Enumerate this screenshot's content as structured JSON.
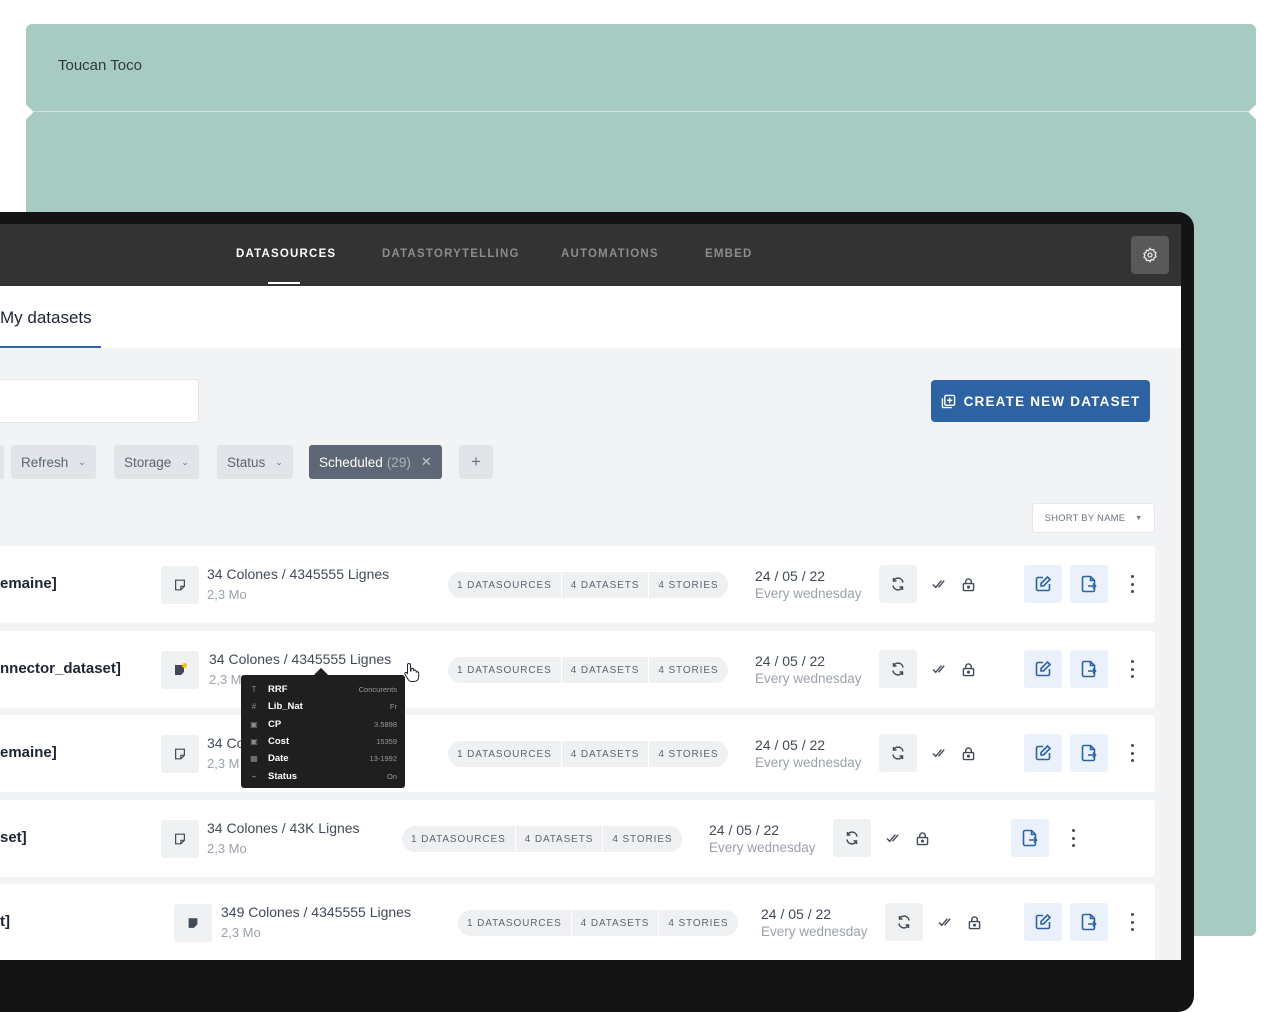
{
  "brand": "Toucan Toco",
  "nav": {
    "items": [
      "DATASOURCES",
      "DATASTORYTELLING",
      "AUTOMATIONS",
      "EMBED"
    ],
    "active": "DATASOURCES"
  },
  "tab": {
    "label": "My datasets"
  },
  "create_button": {
    "label": "CREATE NEW DATASET"
  },
  "filters": {
    "refresh": "Refresh",
    "storage": "Storage",
    "status": "Status",
    "scheduled": "Scheduled",
    "scheduled_count": "(29)",
    "add": "+"
  },
  "sort": {
    "label": "SHORT BY NAME"
  },
  "pills": {
    "datasources": "1 DATASOURCES",
    "datasets": "4 DATASETS",
    "stories": "4 STORIES"
  },
  "rows": [
    {
      "name": "emaine]",
      "colones": "34 Colones",
      "lignes": "/ 4345555 Lignes",
      "size": "2,3 Mo",
      "date": "24 / 05 / 22",
      "schedule": "Every wednesday"
    },
    {
      "name": "nnector_dataset]",
      "colones": "34 Colones",
      "lignes": "/ 4345555 Lignes",
      "size": "2,3 Mo",
      "date": "24 / 05 / 22",
      "schedule": "Every wednesday"
    },
    {
      "name": "emaine]",
      "colones": "34 Co",
      "lignes": "",
      "size": "2,3 M",
      "date": "24 / 05 / 22",
      "schedule": "Every wednesday"
    },
    {
      "name": "set]",
      "colones": "34 Colones",
      "lignes": "/ 43K Lignes",
      "size": "2,3 Mo",
      "date": "24 / 05 / 22",
      "schedule": "Every wednesday"
    },
    {
      "name": "t]",
      "colones": "349 Colones",
      "lignes": "/ 4345555 Lignes",
      "size": "2,3 Mo",
      "date": "24 / 05 / 22",
      "schedule": "Every wednesday"
    }
  ],
  "tooltip": [
    {
      "icon": "T",
      "key": "RRF",
      "value": "Concurents"
    },
    {
      "icon": "#",
      "key": "Lib_Nat",
      "value": "Fr"
    },
    {
      "icon": "▣",
      "key": "CP",
      "value": "3.5898"
    },
    {
      "icon": "▣",
      "key": "Cost",
      "value": "15359"
    },
    {
      "icon": "▦",
      "key": "Date",
      "value": "13-1992"
    },
    {
      "icon": "⌁",
      "key": "Status",
      "value": "On"
    }
  ],
  "colors": {
    "primary": "#2d62a3",
    "nav_bg": "#333333",
    "bg_card": "#a7cbc3"
  }
}
